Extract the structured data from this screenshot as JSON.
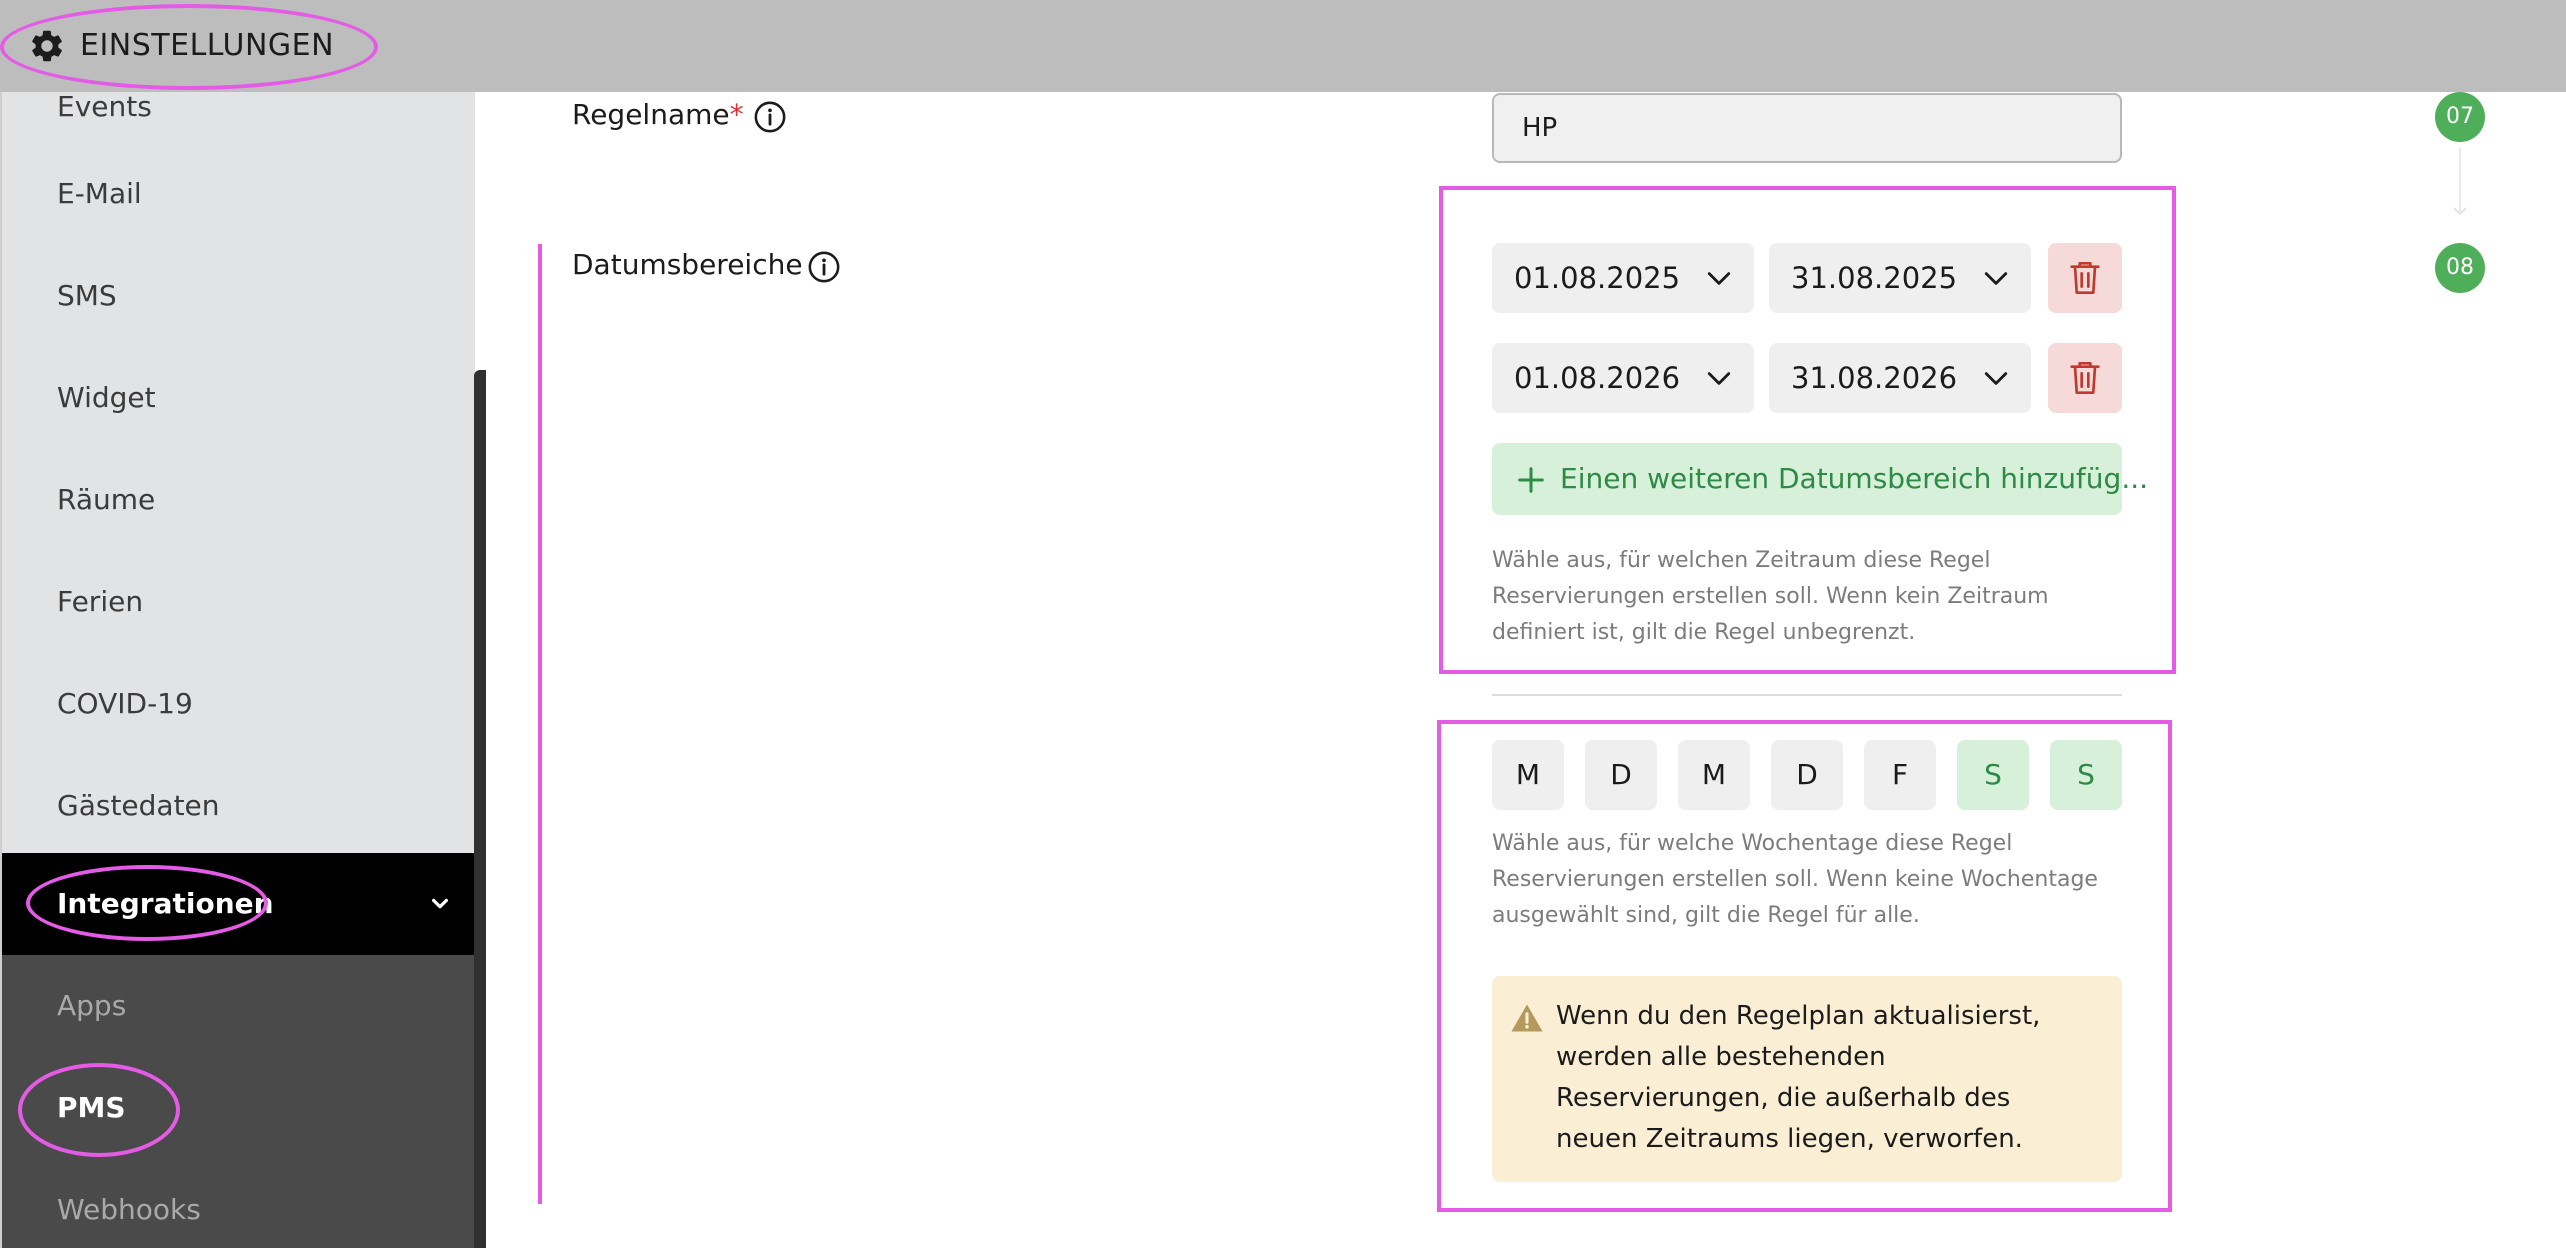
{
  "topbar": {
    "title": "EINSTELLUNGEN",
    "icon": "gear-icon"
  },
  "sidebar": {
    "items": [
      {
        "label": "Events"
      },
      {
        "label": "E-Mail"
      },
      {
        "label": "SMS"
      },
      {
        "label": "Widget"
      },
      {
        "label": "Räume"
      },
      {
        "label": "Ferien"
      },
      {
        "label": "COVID-19"
      },
      {
        "label": "Gästedaten"
      },
      {
        "label": "Integrationen"
      }
    ],
    "subitems": [
      {
        "label": "Apps"
      },
      {
        "label": "PMS"
      },
      {
        "label": "Webhooks"
      }
    ]
  },
  "form": {
    "rule_name_label": "Regelname",
    "required_marker": "*",
    "rule_name_value": "HP",
    "date_ranges_label": "Datumsbereiche",
    "date_ranges": [
      {
        "from": "01.08.2025",
        "to": "31.08.2025"
      },
      {
        "from": "01.08.2026",
        "to": "31.08.2026"
      }
    ],
    "add_range_label": "Einen weiteren Datumsbereich hinzufüg...",
    "date_help": "Wähle aus, für welchen Zeitraum diese Regel Reservierungen erstellen soll. Wenn kein Zeitraum definiert ist, gilt die Regel unbegrenzt.",
    "weekdays": [
      "M",
      "D",
      "M",
      "D",
      "F",
      "S",
      "S"
    ],
    "weekday_help": "Wähle aus, für welche Wochentage diese Regel Reservierungen erstellen soll. Wenn keine Wochentage ausgewählt sind, gilt die Regel für alle.",
    "warning": "Wenn du den Regelplan aktualisierst, werden alle bestehenden Reservierungen, die außerhalb des neuen Zeitraums liegen, verworfen."
  },
  "steps": [
    "07",
    "08"
  ],
  "colors": {
    "highlight": "#e45be6",
    "accent_green": "#4fae5a",
    "danger_bg": "#f6d9d9",
    "warning_bg": "#faefd4"
  }
}
